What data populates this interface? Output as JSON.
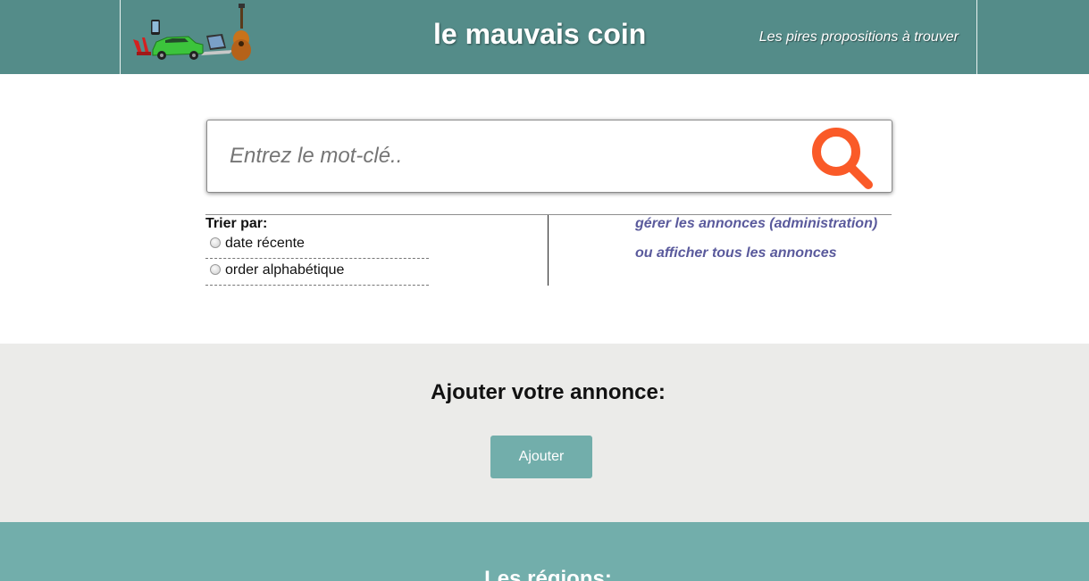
{
  "header": {
    "title": "le mauvais coin",
    "tagline": "Les pires propositions à trouver",
    "logo_icons": [
      "tool-icon",
      "phone-icon",
      "car-icon",
      "laptop-icon",
      "guitar-icon"
    ]
  },
  "search": {
    "placeholder": "Entrez le mot-clé..",
    "value": "",
    "button_icon": "search-icon"
  },
  "sort": {
    "title": "Trier par:",
    "options": [
      {
        "label": "date récente",
        "selected": false
      },
      {
        "label": "order alphabétique",
        "selected": false
      }
    ]
  },
  "links": {
    "admin": "gérer les annonces (administration)",
    "show_all": "ou afficher tous les annonces"
  },
  "add_section": {
    "title": "Ajouter votre annonce:",
    "button_label": "Ajouter"
  },
  "regions": {
    "title": "Les régions:"
  },
  "colors": {
    "header_bg": "#548c89",
    "accent": "#72aeab",
    "search_icon": "#fa5a28",
    "link": "#5a5a9c",
    "add_section_bg": "#ebebe9"
  }
}
